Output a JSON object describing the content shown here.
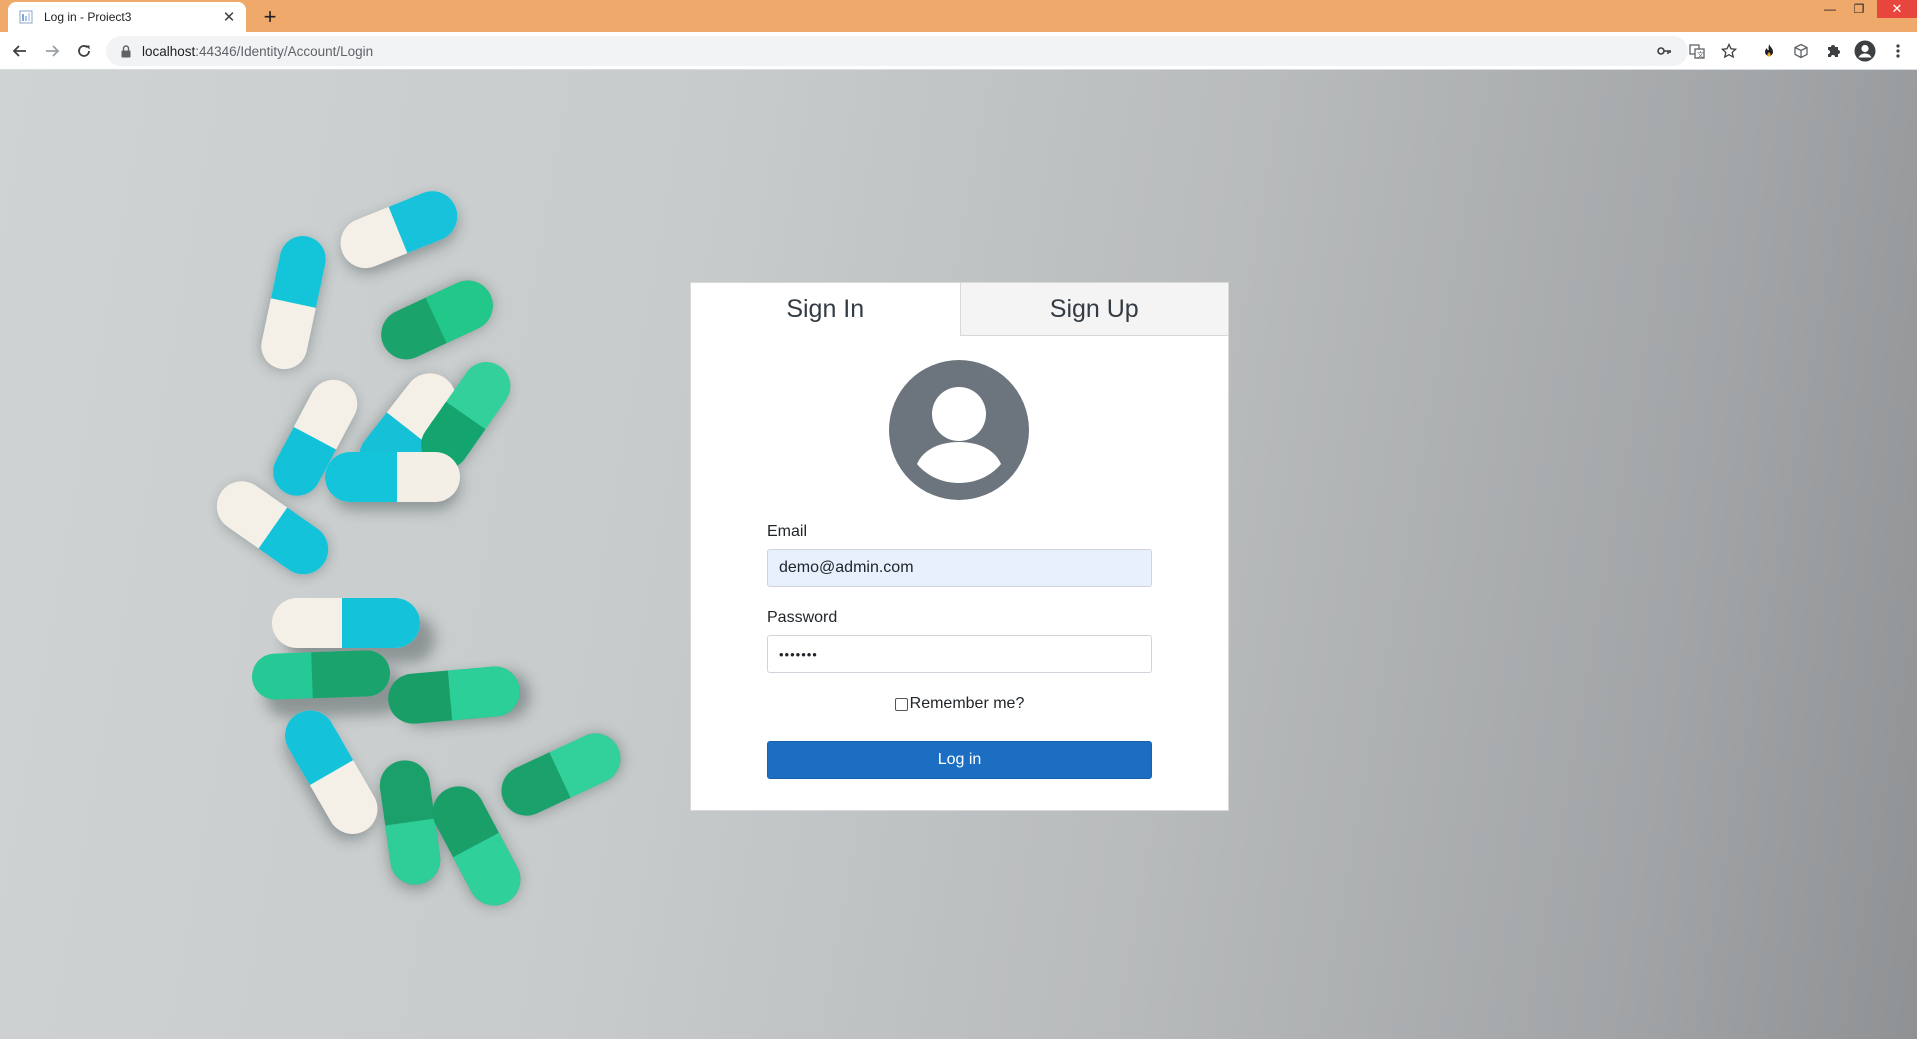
{
  "browser": {
    "tab_title": "Log in - Proiect3",
    "tab_close": "✕",
    "new_tab": "+",
    "url_host": "localhost",
    "url_path": ":44346/Identity/Account/Login",
    "window_controls": {
      "minimize": "—",
      "restore": "❐",
      "close": "✕"
    },
    "toolbar_icons": [
      "back-arrow-icon",
      "forward-arrow-icon",
      "reload-icon",
      "lock-icon",
      "key-icon",
      "translate-icon",
      "star-icon",
      "fire-extension-icon",
      "cube-extension-icon",
      "puzzle-icon",
      "profile-icon",
      "kebab-menu-icon"
    ],
    "chrome_color": "#efa96b"
  },
  "auth": {
    "tabs": [
      {
        "label": "Sign In",
        "active": true
      },
      {
        "label": "Sign Up",
        "active": false
      }
    ],
    "avatar_icon": "user-avatar-icon",
    "email_label": "Email",
    "email_value": "demo@admin.com",
    "password_label": "Password",
    "password_value": "•••••••",
    "remember_label": "Remember me?",
    "remember_checked": false,
    "login_button": "Log in",
    "accent_color": "#1b6ec2"
  },
  "background": {
    "description_icon": "medicine-capsules-background"
  }
}
